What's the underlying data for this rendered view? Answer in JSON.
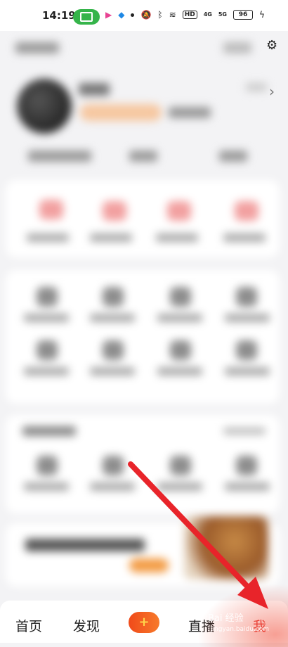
{
  "status_bar": {
    "time": "14:19",
    "battery": "96",
    "icons": [
      "cast-icon",
      "play-icon",
      "app-icon",
      "dot",
      "mute-icon",
      "bluetooth-icon",
      "wifi-icon",
      "hd-icon",
      "signal-4g-icon",
      "signal-5g-icon",
      "battery-icon",
      "charging-icon"
    ],
    "hd_label": "HD",
    "sig1": "4G",
    "sig2": "5G"
  },
  "bottom_nav": {
    "home": "首页",
    "discover": "发现",
    "plus": "+",
    "live": "直播",
    "me": "我"
  },
  "colors": {
    "accent_red": "#e53935",
    "cast_green": "#35b44a",
    "arrow_red": "#e8242a"
  },
  "watermark": {
    "text": "Bai 经验",
    "url": "jingyan.baidu.com"
  }
}
